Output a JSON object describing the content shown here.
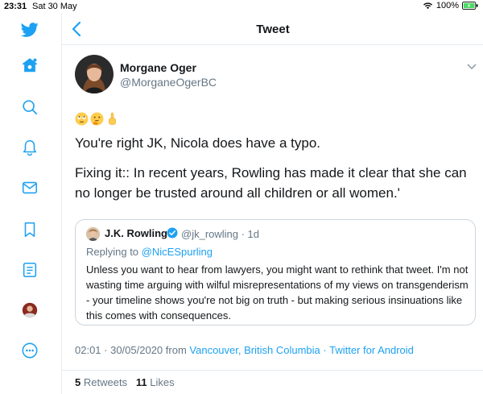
{
  "status_bar": {
    "time": "23:31",
    "date": "Sat 30 May",
    "battery": "100%"
  },
  "sidebar": {
    "items": [
      {
        "icon": "twitter-logo-icon"
      },
      {
        "icon": "home-icon"
      },
      {
        "icon": "search-icon"
      },
      {
        "icon": "notifications-bell-icon"
      },
      {
        "icon": "messages-envelope-icon"
      },
      {
        "icon": "bookmark-icon"
      },
      {
        "icon": "lists-icon"
      },
      {
        "icon": "profile-avatar"
      },
      {
        "icon": "more-icon"
      }
    ]
  },
  "header": {
    "title": "Tweet"
  },
  "tweet": {
    "display_name": "Morgane Oger",
    "handle": "@MorganeOgerBC",
    "emojis": [
      "rolling-eyes-emoji",
      "thinking-face-emoji",
      "pointing-up-emoji"
    ],
    "text_line_1": "You're right JK, Nicola does have a typo.",
    "text_line_2": "Fixing it:: In recent years, Rowling has made it clear that she can no longer be trusted around all children or all women.'",
    "timestamp": "02:01 · 30/05/2020",
    "from_label": "from",
    "location": "Vancouver, British Columbia",
    "separator": "·",
    "client": "Twitter for Android",
    "retweets_count": "5",
    "retweets_label": "Retweets",
    "likes_count": "11",
    "likes_label": "Likes"
  },
  "quoted_tweet": {
    "display_name": "J.K. Rowling",
    "handle_time": "@jk_rowling · 1d",
    "replying_label": "Replying to",
    "replying_to": "@NicESpurling",
    "body": "Unless you want to hear from lawyers, you might want to rethink that tweet. I'm not wasting time arguing with wilful misrepresentations of my views on transgenderism - your timeline shows you're not big on truth - but making serious insinuations like this comes with consequences."
  },
  "colors": {
    "accent": "#1da1f2",
    "text_primary": "#14171a",
    "text_secondary": "#657786",
    "border": "#e6ecf0",
    "battery_green": "#4cd964"
  }
}
